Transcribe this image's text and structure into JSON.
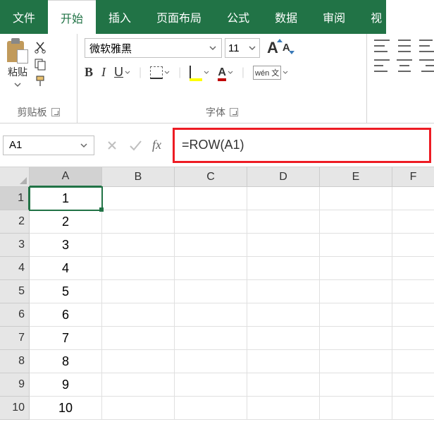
{
  "tabs": {
    "file": "文件",
    "start": "开始",
    "insert": "插入",
    "layout": "页面布局",
    "formula": "公式",
    "data": "数据",
    "review": "审阅",
    "view": "视"
  },
  "ribbon": {
    "clipboard": {
      "label": "剪贴板",
      "paste": "粘贴"
    },
    "font": {
      "label": "字体",
      "name": "微软雅黑",
      "size": "11",
      "bold": "B",
      "italic": "I",
      "underline": "U",
      "wen": "wén 文",
      "Abig": "A",
      "Asmall": "A",
      "Acolor": "A"
    }
  },
  "formula_bar": {
    "cell_ref": "A1",
    "fx": "fx",
    "formula": "=ROW(A1)"
  },
  "grid": {
    "cols": [
      "A",
      "B",
      "C",
      "D",
      "E",
      "F"
    ],
    "rows": [
      "1",
      "2",
      "3",
      "4",
      "5",
      "6",
      "7",
      "8",
      "9",
      "10"
    ],
    "colA": [
      "1",
      "2",
      "3",
      "4",
      "5",
      "6",
      "7",
      "8",
      "9",
      "10"
    ]
  },
  "chart_data": {
    "type": "table",
    "columns": [
      "A"
    ],
    "rows": [
      [
        "1"
      ],
      [
        "2"
      ],
      [
        "3"
      ],
      [
        "4"
      ],
      [
        "5"
      ],
      [
        "6"
      ],
      [
        "7"
      ],
      [
        "8"
      ],
      [
        "9"
      ],
      [
        "10"
      ]
    ]
  }
}
